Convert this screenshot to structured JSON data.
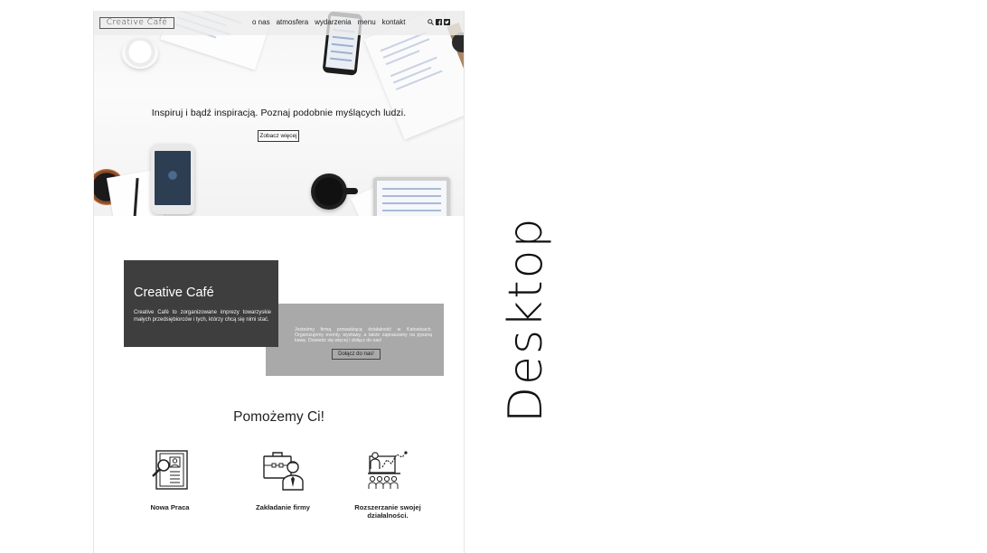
{
  "logo_text": "Creative Café",
  "nav": {
    "items": [
      "o nas",
      "atmosfera",
      "wydarzenia",
      "menu",
      "kontakt"
    ],
    "icons": [
      "search-icon",
      "facebook-icon",
      "twitter-icon"
    ]
  },
  "hero": {
    "headline": "Inspiruj i bądź inspiracją. Poznaj podobnie myślących ludzi.",
    "button_label": "Zobacz więcej"
  },
  "about": {
    "title": "Creative Café",
    "text": "Creative Café to zorganizowane imprezy towarzyskie małych przedsiębiorców i tych, którzy chcą się nimi stać.",
    "grey_text": "Jesteśmy firmą prowadzącą działalność w Katowicach. Organizujemy eventy, wystawy, a także zapraszamy na pyszną kawę. Dowiedz się więcej i dołącz do nas!",
    "join_label": "Dołącz do nas!"
  },
  "help": {
    "title": "Pomożemy Ci!",
    "services": [
      {
        "label": "Nowa Praca",
        "icon": "resume-search-icon"
      },
      {
        "label": "Zakładanie firmy",
        "icon": "briefcase-businessman-icon"
      },
      {
        "label": "Rozszerzanie swojej działalności.",
        "icon": "presentation-audience-icon"
      }
    ]
  },
  "side_title": "Desktop",
  "colors": {
    "dark_box": "#3e3e3e",
    "grey_box": "#a9a9a9",
    "navbar": "#ececec"
  }
}
